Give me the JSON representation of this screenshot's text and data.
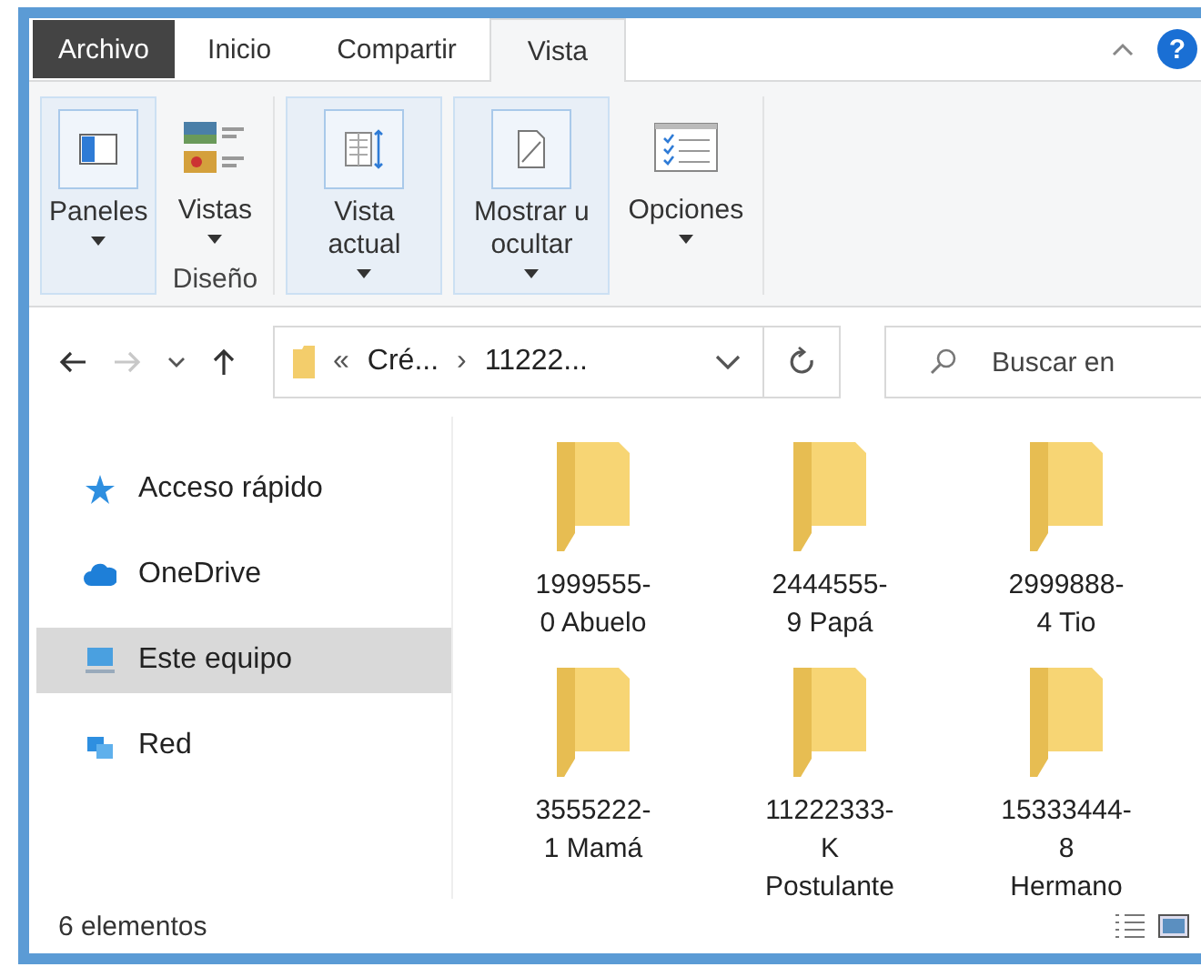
{
  "ribbon_tabs": [
    {
      "label": "Archivo",
      "kind": "file",
      "selected": false
    },
    {
      "label": "Inicio",
      "kind": "tab",
      "selected": false
    },
    {
      "label": "Compartir",
      "kind": "tab",
      "selected": false
    },
    {
      "label": "Vista",
      "kind": "tab",
      "selected": true
    }
  ],
  "help_button": "?",
  "ribbon_items": [
    {
      "label": "Paneles",
      "boxed": true
    },
    {
      "label": "Vistas",
      "boxed": false,
      "group_label": "Diseño"
    },
    {
      "label": "Vista actual",
      "boxed": true
    },
    {
      "label": "Mostrar u ocultar",
      "boxed": true
    },
    {
      "label": "Opciones",
      "boxed": false
    }
  ],
  "navigation": {
    "forward_disabled": true
  },
  "address_bar": {
    "overflow": "«",
    "segments": [
      "Cré...",
      "11222..."
    ],
    "separator": "›"
  },
  "search": {
    "placeholder": "Buscar en"
  },
  "sidebar": {
    "items": [
      {
        "label": "Acceso rápido",
        "selected": false
      },
      {
        "label": "OneDrive",
        "selected": false
      },
      {
        "label": "Este equipo",
        "selected": true
      },
      {
        "label": "Red",
        "selected": false
      }
    ]
  },
  "folders": [
    {
      "name": "1999555-0 Abuelo"
    },
    {
      "name": "2444555-9 Papá"
    },
    {
      "name": "2999888-4 Tio"
    },
    {
      "name": "3555222-1 Mamá"
    },
    {
      "name": "11222333-K Postulante"
    },
    {
      "name": "15333444-8 Hermano"
    }
  ],
  "status_bar": {
    "count": "6 elementos"
  }
}
